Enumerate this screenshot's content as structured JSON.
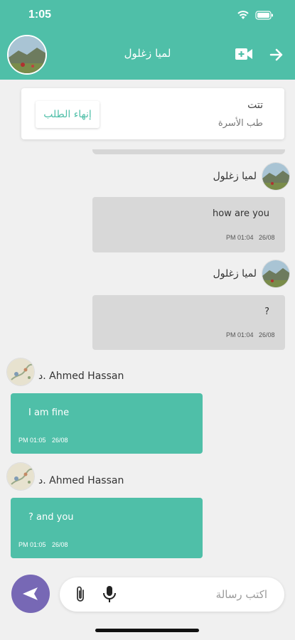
{
  "status_bar": {
    "time": "1:05"
  },
  "header": {
    "title": "لميا زغلول",
    "icons": [
      "video-camera-icon",
      "arrow-right-icon"
    ],
    "color": "#4fbfa8"
  },
  "request_card": {
    "name": "تتت",
    "specialty": "طب الأسرة",
    "end_button": "إنهاء الطلب"
  },
  "messages": [
    {
      "direction": "in",
      "sender": "لميا زغلول",
      "text": "how are you",
      "time": "PM 01:04",
      "date": "26/08"
    },
    {
      "direction": "in",
      "sender": "لميا زغلول",
      "text": "?",
      "time": "PM 01:04",
      "date": "26/08"
    },
    {
      "direction": "out",
      "sender": "د. Ahmed Hassan",
      "text": "I am fine",
      "time": "PM 01:05",
      "date": "26/08"
    },
    {
      "direction": "out",
      "sender": "د. Ahmed Hassan",
      "text": "? and you",
      "time": "PM 01:05",
      "date": "26/08"
    }
  ],
  "composer": {
    "placeholder": "اكتب رسالة",
    "icons": [
      "send-icon",
      "attachment-icon",
      "microphone-icon"
    ],
    "send_color": "#7768b5"
  }
}
